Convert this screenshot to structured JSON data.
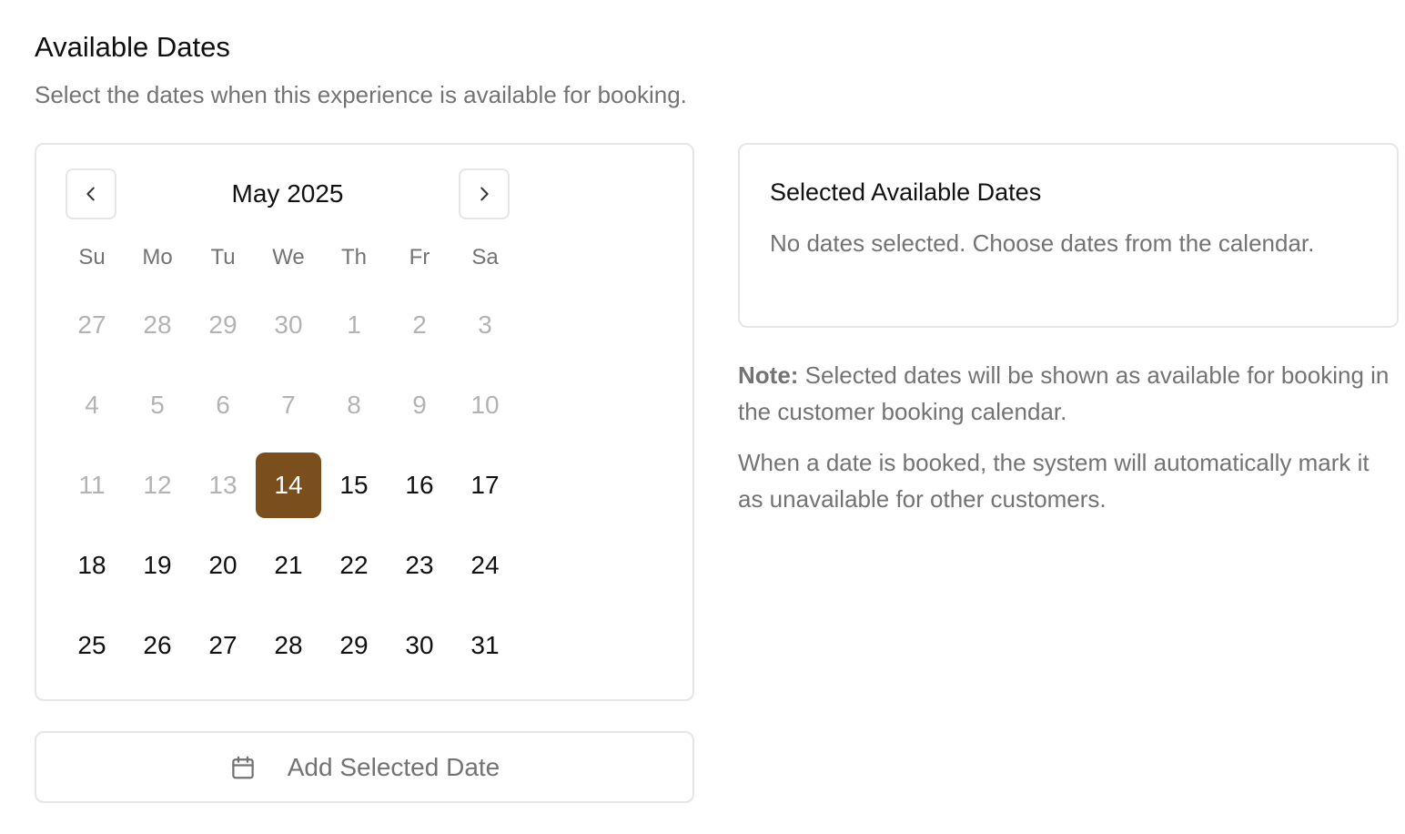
{
  "header": {
    "title": "Available Dates",
    "subtitle": "Select the dates when this experience is available for booking."
  },
  "calendar": {
    "month_label": "May 2025",
    "prev_icon": "chevron-left-icon",
    "next_icon": "chevron-right-icon",
    "weekdays": [
      "Su",
      "Mo",
      "Tu",
      "We",
      "Th",
      "Fr",
      "Sa"
    ],
    "weeks": [
      [
        "27",
        "28",
        "29",
        "30",
        "1",
        "2",
        "3"
      ],
      [
        "4",
        "5",
        "6",
        "7",
        "8",
        "9",
        "10"
      ],
      [
        "11",
        "12",
        "13",
        "14",
        "15",
        "16",
        "17"
      ],
      [
        "18",
        "19",
        "20",
        "21",
        "22",
        "23",
        "24"
      ],
      [
        "25",
        "26",
        "27",
        "28",
        "29",
        "30",
        "31"
      ]
    ],
    "muted_through": 16,
    "selected": "14",
    "selected_color": "#7a4e1d"
  },
  "add_button": {
    "icon": "calendar-icon",
    "label": "Add Selected Date"
  },
  "selected_panel": {
    "title": "Selected Available Dates",
    "empty_text": "No dates selected. Choose dates from the calendar."
  },
  "notes": {
    "label": "Note:",
    "text": " Selected dates will be shown as available for booking in the customer booking calendar.",
    "text2": "When a date is booked, the system will automatically mark it as unavailable for other customers."
  }
}
